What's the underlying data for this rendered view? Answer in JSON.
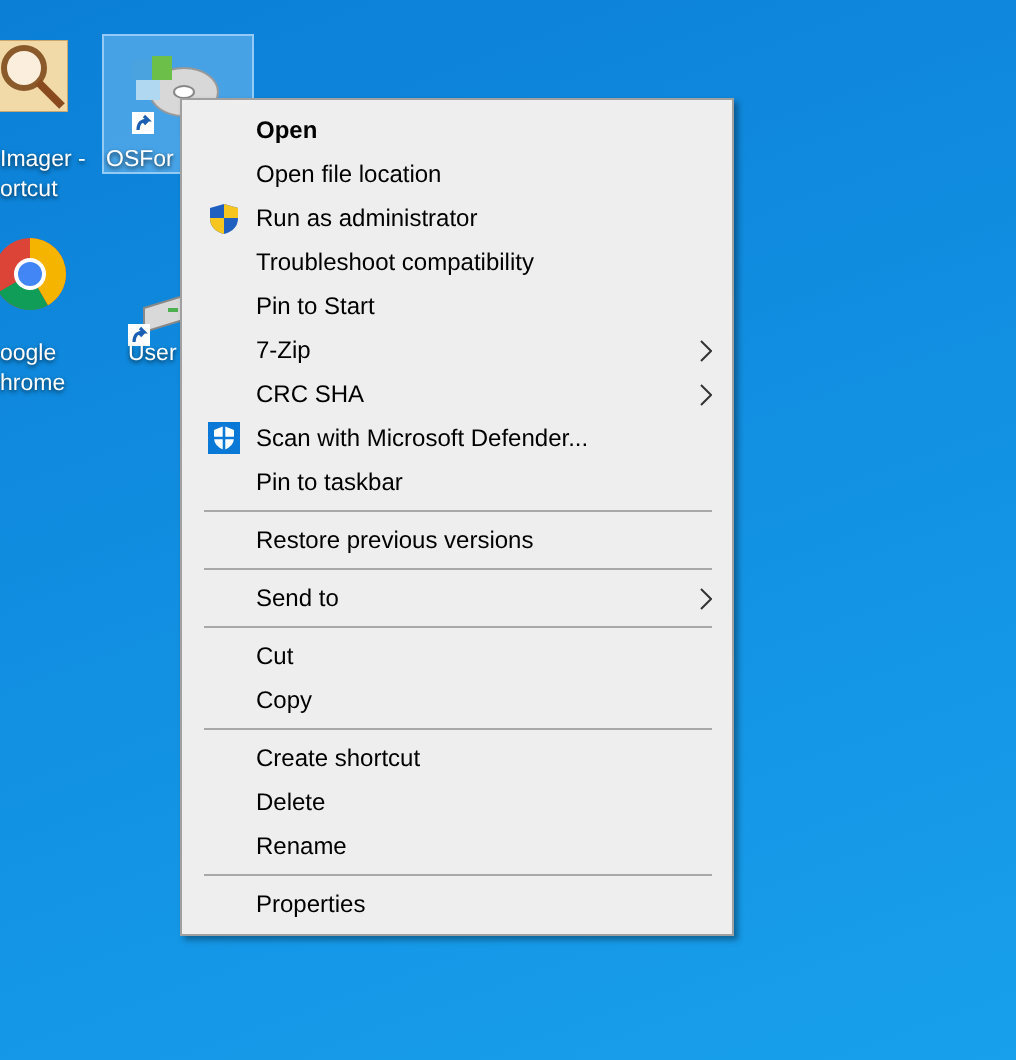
{
  "desktop_icons": [
    {
      "kind": "magnifier",
      "label_lines": [
        "Imager -",
        "ortcut"
      ],
      "selected": false
    },
    {
      "kind": "chrome",
      "label_lines": [
        "oogle",
        "hrome"
      ],
      "selected": false
    },
    {
      "kind": "disc",
      "label_lines": [
        "OSFor"
      ],
      "selected": true
    },
    {
      "kind": "drive",
      "label_lines": [
        "User"
      ],
      "selected": false
    }
  ],
  "context_menu": {
    "items": [
      {
        "kind": "item",
        "label": "Open",
        "default": true,
        "submenu": false
      },
      {
        "kind": "item",
        "label": "Open file location",
        "default": false,
        "submenu": false
      },
      {
        "kind": "elevate",
        "label": "Run as administrator",
        "default": false,
        "submenu": false
      },
      {
        "kind": "item",
        "label": "Troubleshoot compatibility",
        "default": false,
        "submenu": false
      },
      {
        "kind": "item",
        "label": "Pin to Start",
        "default": false,
        "submenu": false
      },
      {
        "kind": "item",
        "label": "7-Zip",
        "default": false,
        "submenu": true
      },
      {
        "kind": "item",
        "label": "CRC SHA",
        "default": false,
        "submenu": true
      },
      {
        "kind": "scan",
        "label": "Scan with Microsoft Defender...",
        "default": false,
        "submenu": false
      },
      {
        "kind": "item",
        "label": "Pin to taskbar",
        "default": false,
        "submenu": false
      },
      {
        "kind": "separator"
      },
      {
        "kind": "item",
        "label": "Restore previous versions",
        "default": false,
        "submenu": false
      },
      {
        "kind": "separator"
      },
      {
        "kind": "item",
        "label": "Send to",
        "default": false,
        "submenu": true
      },
      {
        "kind": "separator"
      },
      {
        "kind": "item",
        "label": "Cut",
        "default": false,
        "submenu": false
      },
      {
        "kind": "item",
        "label": "Copy",
        "default": false,
        "submenu": false
      },
      {
        "kind": "separator"
      },
      {
        "kind": "item",
        "label": "Create shortcut",
        "default": false,
        "submenu": false
      },
      {
        "kind": "item",
        "label": "Delete",
        "default": false,
        "submenu": false
      },
      {
        "kind": "item",
        "label": "Rename",
        "default": false,
        "submenu": false
      },
      {
        "kind": "separator"
      },
      {
        "kind": "item",
        "label": "Properties",
        "default": false,
        "submenu": false
      }
    ]
  }
}
